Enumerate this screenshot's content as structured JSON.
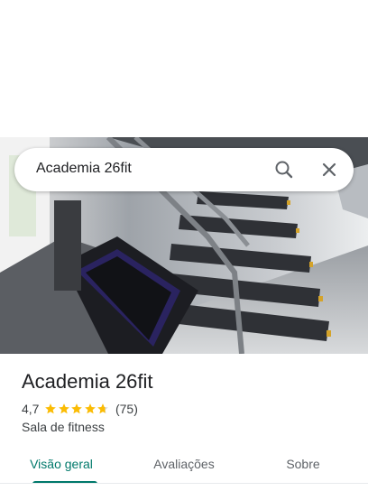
{
  "search": {
    "query": "Academia 26fit"
  },
  "place": {
    "name": "Academia 26fit",
    "rating": "4,7",
    "rating_value": 4.7,
    "rating_max": 5,
    "review_count": "(75)",
    "category": "Sala de fitness"
  },
  "tabs": [
    {
      "label": "Visão geral",
      "active": true
    },
    {
      "label": "Avaliações",
      "active": false
    },
    {
      "label": "Sobre",
      "active": false
    }
  ],
  "icons": {
    "search": "search-icon",
    "close": "close-icon",
    "star": "star-icon"
  },
  "colors": {
    "accent": "#00796b",
    "star": "#fbbc04",
    "text_primary": "#202124",
    "text_secondary": "#3c4043"
  }
}
